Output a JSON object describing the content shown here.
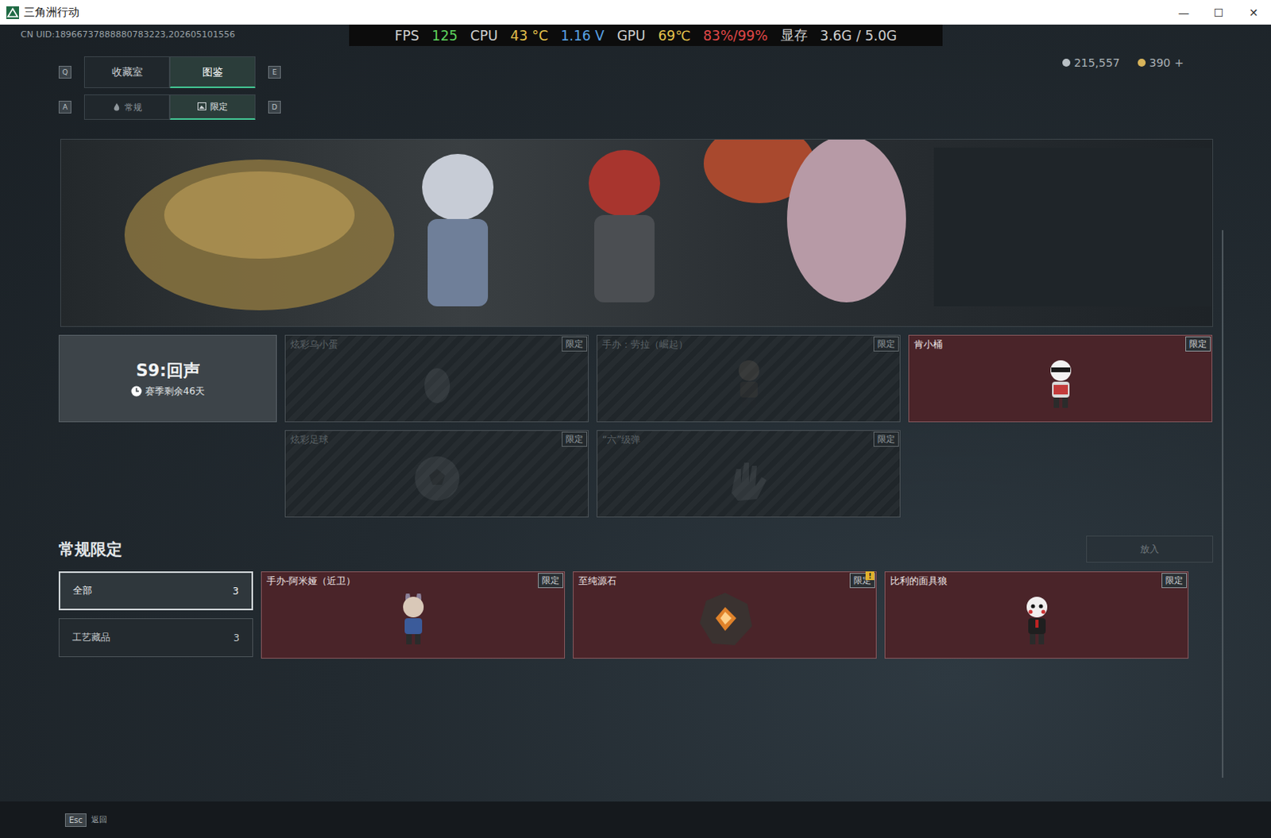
{
  "window": {
    "title": "三角洲行动",
    "controls": [
      "—",
      "☐",
      "✕"
    ]
  },
  "overlay": [
    {
      "text": "FPS",
      "color": "#d0d0d0"
    },
    {
      "text": "125",
      "color": "#5ed35e"
    },
    {
      "text": "CPU",
      "color": "#d0d0d0"
    },
    {
      "text": "43 °C",
      "color": "#e6c34c"
    },
    {
      "text": "1.16 V",
      "color": "#5aa4e6"
    },
    {
      "text": "GPU",
      "color": "#d0d0d0"
    },
    {
      "text": "69℃",
      "color": "#e6c34c"
    },
    {
      "text": "83%/99%",
      "color": "#e04848"
    },
    {
      "text": "显存",
      "color": "#d0d0d0"
    },
    {
      "text": "3.6G / 5.0G",
      "color": "#d0d0d0"
    }
  ],
  "uid": "CN UID:18966737888880783223,202605101556",
  "currency": [
    {
      "amount": "215,557",
      "suffix": "",
      "color": "#b8bfc4"
    },
    {
      "amount": "390",
      "suffix": "+",
      "color": "#d8b45a"
    }
  ],
  "tabs": {
    "prev_key": "Q",
    "next_key": "E",
    "items": [
      {
        "label": "收藏室",
        "selected": false
      },
      {
        "label": "图鉴",
        "selected": true
      }
    ]
  },
  "subtabs": {
    "prev_key": "A",
    "next_key": "D",
    "items": [
      {
        "label": "常规",
        "selected": false
      },
      {
        "label": "限定",
        "selected": true
      }
    ]
  },
  "season": {
    "title": "S9:回声",
    "remaining": "赛季剩余46天"
  },
  "season_items": [
    {
      "name": "炫彩乌小蛋",
      "badge": "限定",
      "owned": false
    },
    {
      "name": "手办：劳拉（崛起）",
      "badge": "限定",
      "owned": false
    },
    {
      "name": "肯小桶",
      "badge": "限定",
      "owned": true
    },
    {
      "name": "炫彩足球",
      "badge": "限定",
      "owned": false
    },
    {
      "name": "“六”级弹",
      "badge": "限定",
      "owned": false
    }
  ],
  "section": {
    "title": "常规限定",
    "action": {
      "label": "放入",
      "disabled": true
    }
  },
  "filters": [
    {
      "label": "全部",
      "count": "3",
      "selected": true
    },
    {
      "label": "工艺藏品",
      "count": "3",
      "selected": false
    }
  ],
  "items": [
    {
      "name": "手办-阿米娅（近卫）",
      "badge": "限定",
      "owned": true,
      "notice": ""
    },
    {
      "name": "至纯源石",
      "badge": "限定",
      "owned": true,
      "notice": "!"
    },
    {
      "name": "比利的面具狼",
      "badge": "限定",
      "owned": true,
      "notice": ""
    }
  ],
  "footer": {
    "key": "Esc",
    "label": "返回"
  }
}
